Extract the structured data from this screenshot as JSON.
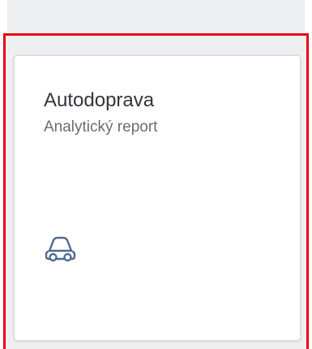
{
  "tile": {
    "title": "Autodoprava",
    "subtitle": "Analytický report",
    "icon": "car-icon"
  },
  "colors": {
    "highlight_border": "#e8000d",
    "icon": "#4f6c8e",
    "background": "#edeff0"
  }
}
